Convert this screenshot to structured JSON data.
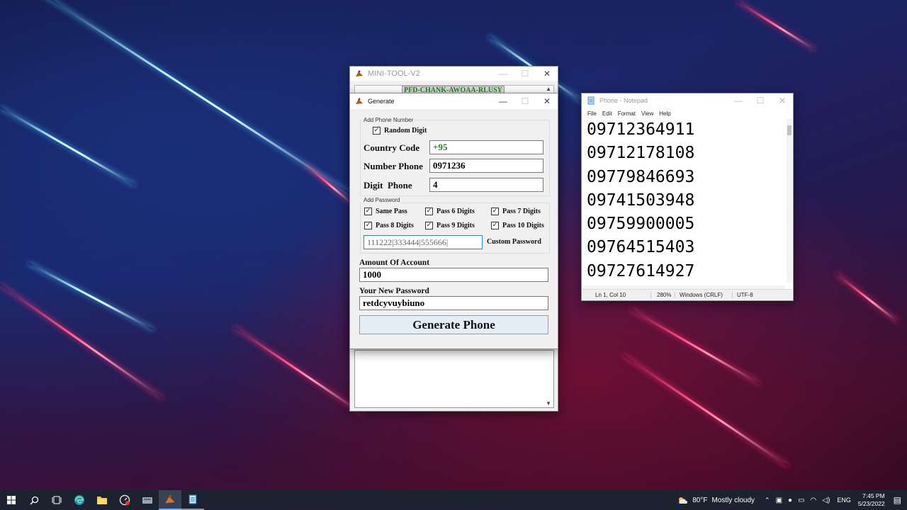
{
  "mini_tool": {
    "title": "MINI-TOOL-V2",
    "license_key": "PFD-CHANK-AWOAA-RLUSY",
    "controls": {
      "minimize": "—",
      "maximize": "☐",
      "close": "✕"
    }
  },
  "generate": {
    "title": "Generate",
    "controls": {
      "minimize": "—",
      "maximize": "☐",
      "close": "✕"
    },
    "phone_group_label": "Add Phone Number",
    "random_digit_label": "Random Digit",
    "random_digit_checked": "✓",
    "country_code_label": "Country Code",
    "country_code_value": "+95",
    "number_phone_label": "Number Phone",
    "number_phone_value": "0971236",
    "digit_phone_label": "Digit  Phone",
    "digit_phone_value": "4",
    "password_group_label": "Add Password",
    "pass_options": [
      {
        "label": "Same Pass",
        "mark": "✓"
      },
      {
        "label": "Pass 6 Digits",
        "mark": "✓"
      },
      {
        "label": "Pass 7 Digits",
        "mark": "✓"
      },
      {
        "label": "Pass 8 Digits",
        "mark": "✓"
      },
      {
        "label": "Pass 9 Digits",
        "mark": "✓"
      },
      {
        "label": "Pass 10 Digits",
        "mark": "✓"
      }
    ],
    "custom_password_value": "111222|333444|555666|",
    "custom_password_label": "Custom Password",
    "amount_label": "Amount Of Account",
    "amount_value": "1000",
    "new_password_label": "Your New Password",
    "new_password_value": "retdcyvuybiuno",
    "generate_button": "Generate Phone"
  },
  "notepad": {
    "title": "Phone - Notepad",
    "controls": {
      "minimize": "—",
      "maximize": "☐",
      "close": "✕"
    },
    "menu": [
      "File",
      "Edit",
      "Format",
      "View",
      "Help"
    ],
    "lines": [
      "09712364911",
      "09712178108",
      "09779846693",
      "09741503948",
      "09759900005",
      "09764515403",
      "09727614927"
    ],
    "status": {
      "position": "Ln 1, Col 10",
      "zoom": "280%",
      "line_ending": "Windows (CRLF)",
      "encoding": "UTF-8"
    }
  },
  "taskbar": {
    "weather_temp": "80°F",
    "weather_text": "Mostly cloudy",
    "language": "ENG",
    "time": "7:45 PM",
    "date": "5/23/2022"
  },
  "colors": {
    "green_text": "#1a8a1a",
    "accent": "#0078d4"
  }
}
